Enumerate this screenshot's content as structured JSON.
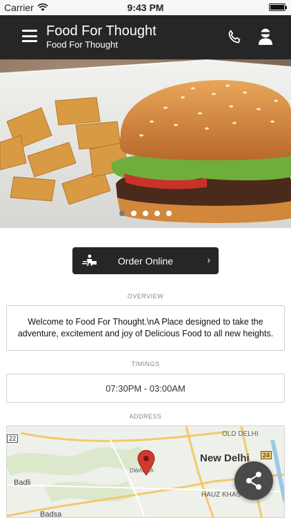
{
  "status_bar": {
    "carrier": "Carrier",
    "time": "9:43 PM"
  },
  "header": {
    "title": "Food For Thought",
    "subtitle": "Food For Thought"
  },
  "hero": {
    "slide_count": 5,
    "active_slide": 0
  },
  "order": {
    "label": "Order Online",
    "chevron": "›"
  },
  "overview": {
    "label": "OVERVIEW",
    "text": "Welcome to Food For Thought.\\nA Place designed to take the adventure, excitement and joy of Delicious Food to all new heights."
  },
  "timings": {
    "label": "TIMINGS",
    "value": "07:30PM - 03:00AM"
  },
  "address": {
    "label": "ADDRESS",
    "map": {
      "old_delhi": "OLD DELHI",
      "new_delhi": "New Delhi",
      "dwarka": "DWARKA",
      "badli": "Badli",
      "hauz_khas": "HAUZ KHAS",
      "badsa": "Badsa",
      "shield_22": "22",
      "shield_24": "24"
    }
  },
  "colors": {
    "header_bg": "#262626",
    "button_bg": "#262626",
    "map_pin": "#d23a2f",
    "fab_bg": "#4a4a4a"
  },
  "icons": [
    "menu-icon",
    "phone-icon",
    "user-icon",
    "delivery-icon",
    "chevron-right-icon",
    "share-icon",
    "map-pin-icon",
    "wifi-icon",
    "battery-icon"
  ]
}
